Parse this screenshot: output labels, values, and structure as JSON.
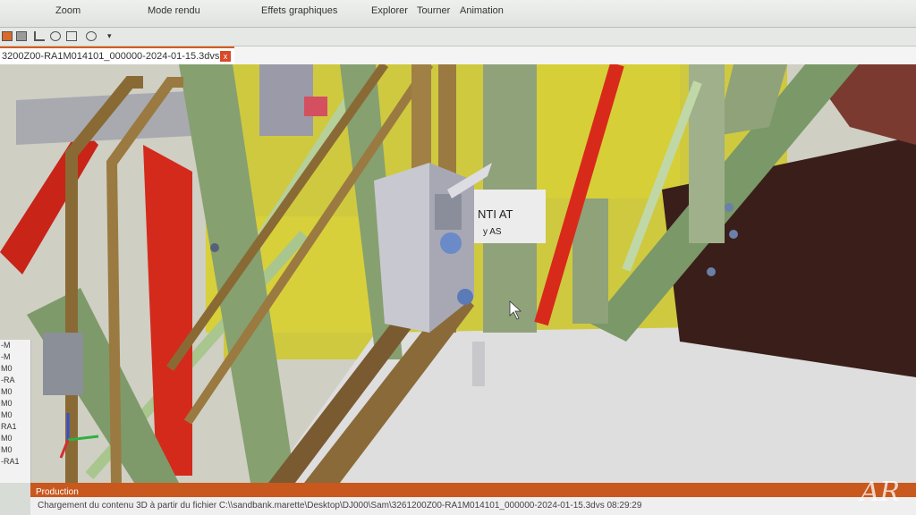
{
  "ribbon": {
    "zoom_label": "Zoom",
    "render_label": "Mode rendu",
    "effects_label": "Effets graphiques",
    "explore_label": "Explorer",
    "rotate_label": "Tourner",
    "animation_label": "Animation"
  },
  "document": {
    "tab_title": "3200Z00-RA1M014101_000000-2024-01-15.3dvs",
    "close_glyph": "x"
  },
  "tree": {
    "items": [
      "-M",
      "-M",
      "M0",
      "-RA",
      "M0",
      "M0",
      "M0",
      "RA1",
      "M0",
      "M0",
      "-RA1"
    ]
  },
  "viewport": {
    "overlay_text": "NTI AT",
    "overlay_text2": "y AS"
  },
  "production": {
    "label": "Production",
    "message": "Chargement du contenu 3D à partir du fichier C:\\\\sandbank.marette\\Desktop\\DJ000\\Sam\\3261200Z00-RA1M014101_000000-2024-01-15.3dvs 08:29:29"
  },
  "watermark": "AR",
  "colors": {
    "accent": "#d85a1a",
    "frame_green": "#8fa27a",
    "tube_brown": "#8a6a34",
    "panel_yellow": "#d8d03a",
    "pipe_red": "#d82a1a",
    "floor": "#dedede"
  }
}
